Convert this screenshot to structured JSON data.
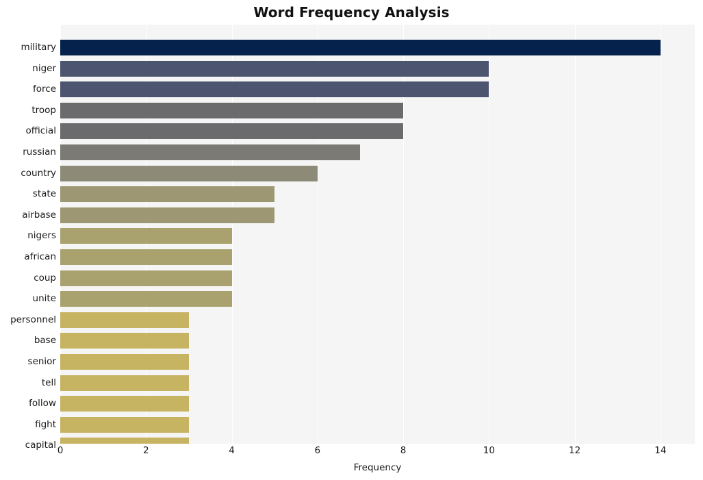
{
  "chart_data": {
    "type": "bar",
    "orientation": "horizontal",
    "title": "Word Frequency Analysis",
    "xlabel": "Frequency",
    "ylabel": "",
    "xlim": [
      0,
      14.8
    ],
    "ylim": [
      0,
      20
    ],
    "grid": true,
    "gridlines": "vertical",
    "legend": null,
    "xticks": [
      "0",
      "2",
      "4",
      "6",
      "8",
      "10",
      "12",
      "14"
    ],
    "xtick_values": [
      0,
      2,
      4,
      6,
      8,
      10,
      12,
      14
    ],
    "categories": [
      "military",
      "niger",
      "force",
      "troop",
      "official",
      "russian",
      "country",
      "state",
      "airbase",
      "nigers",
      "african",
      "coup",
      "unite",
      "personnel",
      "base",
      "senior",
      "tell",
      "follow",
      "fight",
      "capital"
    ],
    "values": [
      14,
      10,
      10,
      8,
      8,
      7,
      6,
      5,
      5,
      4,
      4,
      4,
      4,
      3,
      3,
      3,
      3,
      3,
      3,
      3
    ],
    "bar_colors": [
      "#04224c",
      "#4d5470",
      "#4d5470",
      "#6b6b6e",
      "#6b6b6e",
      "#7b7a75",
      "#8d8a78",
      "#9d9873",
      "#9d9873",
      "#a9a26e",
      "#a9a26e",
      "#a9a26e",
      "#a9a26e",
      "#c6b462",
      "#c6b462",
      "#c6b462",
      "#c6b462",
      "#c6b462",
      "#c6b462",
      "#c6b462"
    ],
    "plot_background": "#f5f5f5",
    "figure_background": "#ffffff",
    "gridline_color": "#ffffff"
  }
}
